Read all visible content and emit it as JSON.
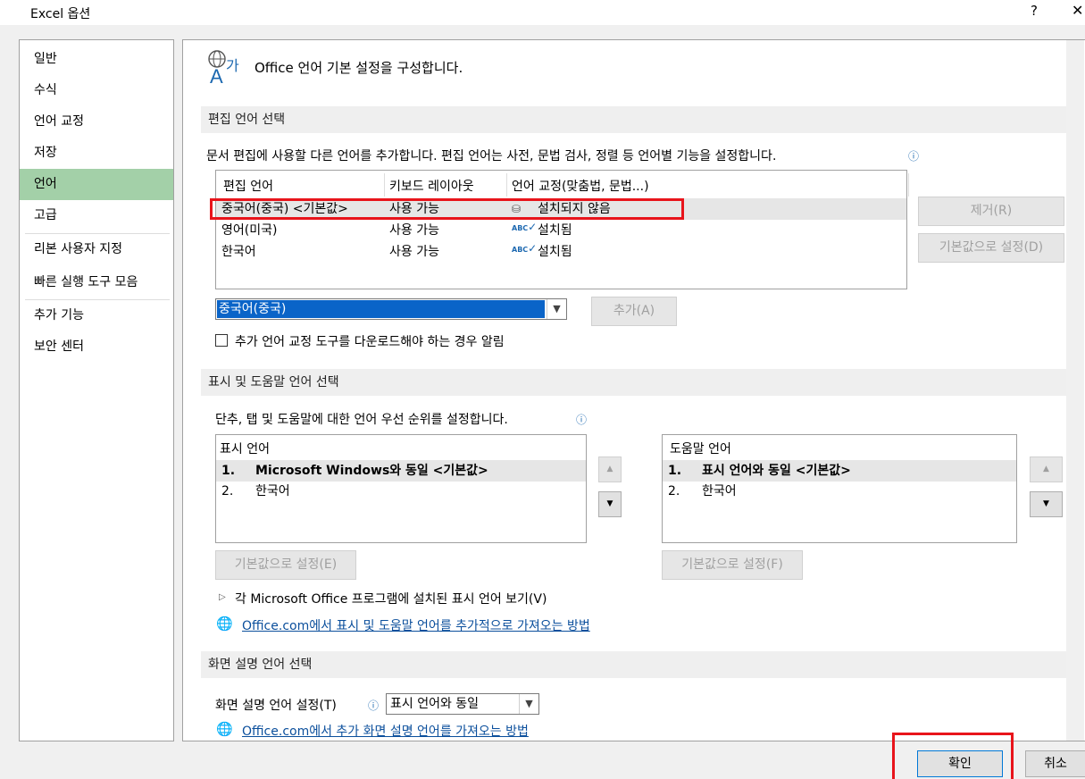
{
  "window": {
    "title": "Excel 옵션",
    "help": "?",
    "close": "✕"
  },
  "sidebar": {
    "items": [
      {
        "label": "일반"
      },
      {
        "label": "수식"
      },
      {
        "label": "언어 교정"
      },
      {
        "label": "저장"
      },
      {
        "label": "언어"
      },
      {
        "label": "고급"
      },
      {
        "label": "리본 사용자 지정"
      },
      {
        "label": "빠른 실행 도구 모음"
      },
      {
        "label": "추가 기능"
      },
      {
        "label": "보안 센터"
      }
    ],
    "selected": "언어"
  },
  "header": {
    "text": "Office 언어 기본 설정을 구성합니다."
  },
  "editing": {
    "section_title": "편집 언어 선택",
    "description": "문서 편집에 사용할 다른 언어를 추가합니다. 편집 언어는 사전, 문법 검사, 정렬 등 언어별 기능을 설정합니다.",
    "columns": [
      "편집 언어",
      "키보드 레이아웃",
      "언어 교정(맞춤법, 문법...)"
    ],
    "rows": [
      {
        "lang": "중국어(중국) <기본값>",
        "keyboard": "사용 가능",
        "proofing": "설치되지 않음"
      },
      {
        "lang": "영어(미국)",
        "keyboard": "사용 가능",
        "proofing": "설치됨"
      },
      {
        "lang": "한국어",
        "keyboard": "사용 가능",
        "proofing": "설치됨"
      }
    ],
    "remove_btn": "제거(R)",
    "set_default_btn": "기본값으로 설정(D)",
    "add_select_value": "중국어(중국)",
    "add_btn": "추가(A)",
    "notify_checkbox": "추가 언어 교정 도구를 다운로드해야 하는 경우 알림",
    "spell_glyph": "ABC"
  },
  "display": {
    "section_title": "표시 및 도움말 언어 선택",
    "description": "단추, 탭 및 도움말에 대한 언어 우선 순위를 설정합니다.",
    "display_lang": {
      "header": "표시 언어",
      "items": [
        {
          "num": "1.",
          "label": "Microsoft Windows와 동일 <기본값>"
        },
        {
          "num": "2.",
          "label": "한국어"
        }
      ],
      "set_default_btn": "기본값으로 설정(E)"
    },
    "help_lang": {
      "header": "도움말 언어",
      "items": [
        {
          "num": "1.",
          "label": "표시 언어와 동일 <기본값>"
        },
        {
          "num": "2.",
          "label": "한국어"
        }
      ],
      "set_default_btn": "기본값으로 설정(F)"
    },
    "view_installed": "각 Microsoft Office 프로그램에 설치된 표시 언어 보기(V)",
    "get_more_link": "Office.com에서 표시 및 도움말 언어를 추가적으로 가져오는 방법"
  },
  "screentip": {
    "section_title": "화면 설명 언어 선택",
    "label": "화면 설명 언어 설정(T)",
    "select_value": "표시 언어와 동일",
    "get_more_link": "Office.com에서 추가 화면 설명 언어를 가져오는 방법"
  },
  "footer": {
    "ok": "확인",
    "cancel": "취소"
  },
  "colors": {
    "accent_selected": "#a3d0a8",
    "highlight": "#e8141b",
    "link": "#0b4f9c",
    "select_blue": "#0a64c8"
  }
}
